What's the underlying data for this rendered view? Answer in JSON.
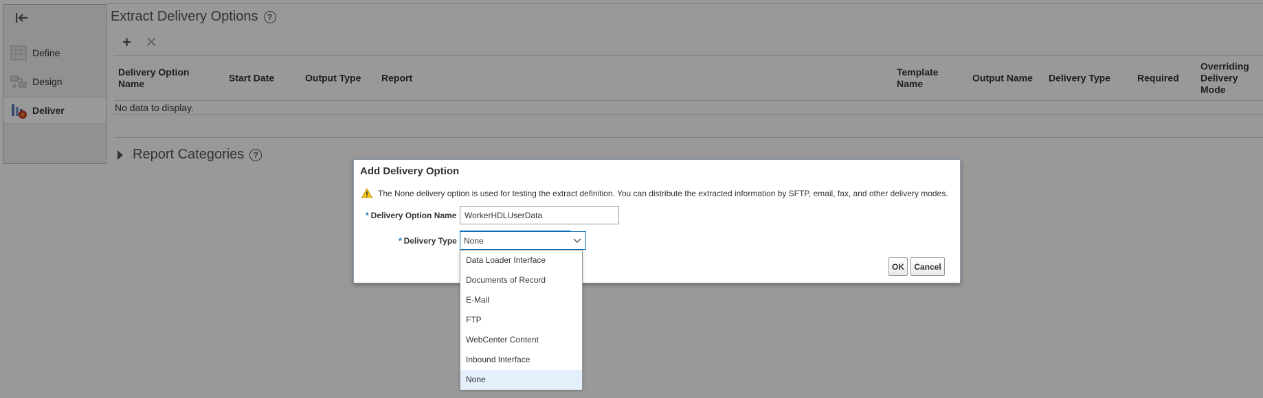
{
  "left_nav": {
    "items": [
      {
        "label": "Define"
      },
      {
        "label": "Design"
      },
      {
        "label": "Deliver"
      }
    ]
  },
  "page": {
    "title": "Extract Delivery Options"
  },
  "table": {
    "columns": [
      "Delivery Option Name",
      "Start Date",
      "Output Type",
      "Report",
      "Template Name",
      "Output Name",
      "Delivery Type",
      "Required",
      "Overriding Delivery Mode"
    ],
    "empty_text": "No data to display."
  },
  "report_categories": {
    "label": "Report Categories"
  },
  "dialog": {
    "title": "Add Delivery Option",
    "warning": "The None delivery option is used for testing the extract definition. You can distribute the extracted information by SFTP, email, fax, and other delivery modes.",
    "fields": {
      "name_label": "Delivery Option Name",
      "name_value": "WorkerHDLUserData",
      "type_label": "Delivery Type",
      "type_value": "None"
    },
    "ok_label": "OK",
    "cancel_label": "Cancel"
  },
  "dropdown": {
    "options": [
      "Data Loader Interface",
      "Documents of Record",
      "E-Mail",
      "FTP",
      "WebCenter Content",
      "Inbound Interface",
      "None"
    ],
    "selected": "None"
  },
  "colors": {
    "accent": "#0b6fb6",
    "overlay": "rgba(0,0,0,0.4)",
    "selected_option_bg": "#e3effa",
    "warning": "#f5c518"
  }
}
